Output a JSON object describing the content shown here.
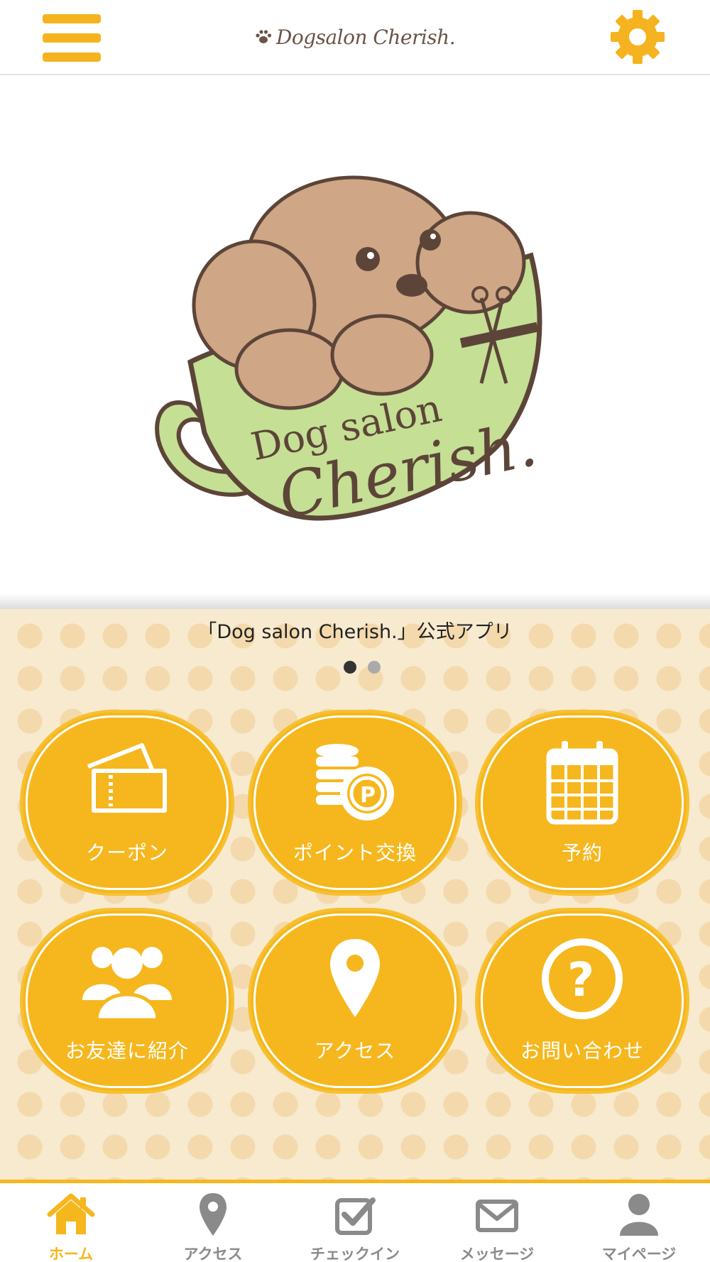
{
  "header": {
    "title": "Dogsalon Cherish.",
    "menu_icon": "hamburger-menu-icon",
    "settings_icon": "gear-icon",
    "accent_color": "#f5b320"
  },
  "hero": {
    "logo_text_line1": "Dog salon",
    "logo_text_line2": "Cherish."
  },
  "main": {
    "caption": "「Dog salon Cherish.」公式アプリ",
    "carousel": {
      "page_count": 2,
      "active_index": 0
    },
    "tiles": [
      {
        "label": "クーポン",
        "icon": "ticket-icon"
      },
      {
        "label": "ポイント交換",
        "icon": "point-coins-icon"
      },
      {
        "label": "予約",
        "icon": "calendar-icon"
      },
      {
        "label": "お友達に紹介",
        "icon": "users-group-icon"
      },
      {
        "label": "アクセス",
        "icon": "map-pin-icon"
      },
      {
        "label": "お問い合わせ",
        "icon": "question-circle-icon"
      }
    ],
    "tile_color": "#f5b71d"
  },
  "tabbar": {
    "active_index": 0,
    "active_color": "#f5b71d",
    "inactive_color": "#8a8a8a",
    "tabs": [
      {
        "label": "ホーム",
        "icon": "home-icon"
      },
      {
        "label": "アクセス",
        "icon": "map-pin-icon"
      },
      {
        "label": "チェックイン",
        "icon": "checkin-checkbox-icon"
      },
      {
        "label": "メッセージ",
        "icon": "envelope-icon"
      },
      {
        "label": "マイページ",
        "icon": "user-icon"
      }
    ]
  }
}
